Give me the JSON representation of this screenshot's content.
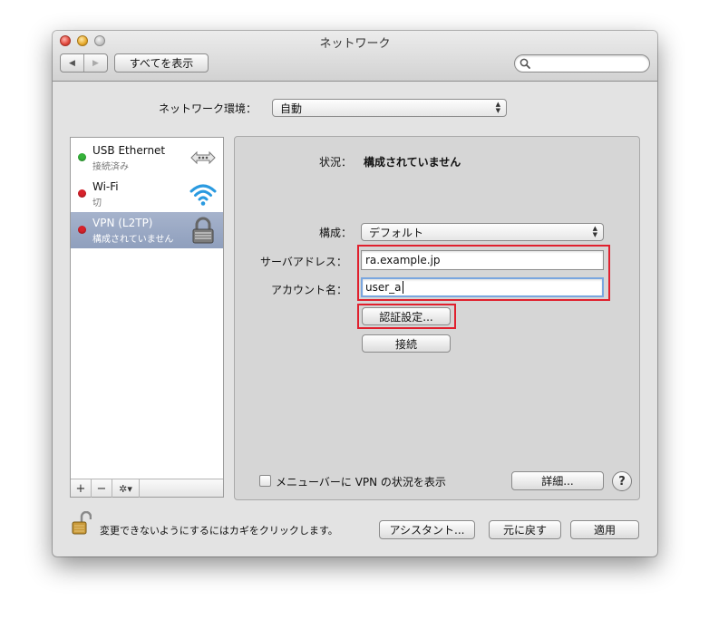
{
  "window": {
    "title": "ネットワーク"
  },
  "toolbar": {
    "show_all_label": "すべてを表示",
    "search_placeholder": "",
    "back_icon": "◀",
    "forward_icon": "▶"
  },
  "location": {
    "label": "ネットワーク環境：",
    "value": "自動"
  },
  "services": [
    {
      "name": "USB Ethernet",
      "status": "接続済み",
      "dot_color": "#36b43a",
      "icon": "ethernet-icon"
    },
    {
      "name": "Wi-Fi",
      "status": "切",
      "dot_color": "#d8222b",
      "icon": "wifi-icon"
    },
    {
      "name": "VPN (L2TP)",
      "status": "構成されていません",
      "dot_color": "#d8222b",
      "icon": "lock-icon",
      "selected": true
    }
  ],
  "sidebar_buttons": {
    "add": "+",
    "remove": "−",
    "action": "✲▾"
  },
  "detail": {
    "status_label": "状況：",
    "status_value": "構成されていません",
    "config_label": "構成：",
    "config_value": "デフォルト",
    "server_label": "サーバアドレス：",
    "server_value": "ra.example.jp",
    "account_label": "アカウント名：",
    "account_value": "user_a",
    "auth_button": "認証設定...",
    "connect_button": "接続",
    "menubar_checkbox_label": "メニューバーに VPN の状況を表示",
    "menubar_checkbox_checked": false,
    "advanced_button": "詳細...",
    "help_button": "?"
  },
  "footer": {
    "lock_text": "変更できないようにするにはカギをクリックします。",
    "assistant_button": "アシスタント...",
    "revert_button": "元に戻す",
    "apply_button": "適用"
  },
  "colors": {
    "highlight": "#e0202e",
    "selection": "#97a6c2",
    "focus_ring": "#7aa6df"
  }
}
